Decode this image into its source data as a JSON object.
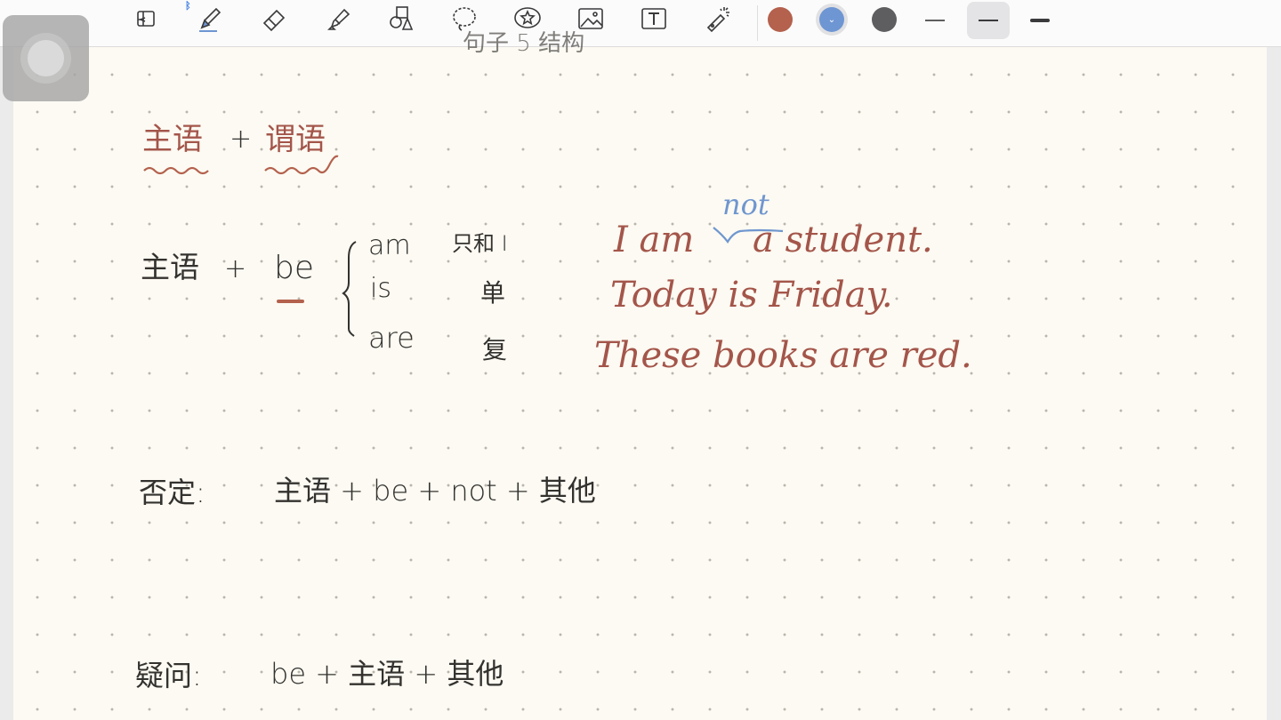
{
  "toolbar": {
    "tools": [
      {
        "id": "read-mode",
        "icon": "read-mode-icon",
        "selected": false
      },
      {
        "id": "pen",
        "icon": "pen-icon",
        "selected": true
      },
      {
        "id": "eraser",
        "icon": "eraser-icon",
        "selected": false
      },
      {
        "id": "highlighter",
        "icon": "highlighter-icon",
        "selected": false
      },
      {
        "id": "shapes",
        "icon": "shapes-icon",
        "selected": false
      },
      {
        "id": "lasso",
        "icon": "lasso-icon",
        "selected": false
      },
      {
        "id": "sticker",
        "icon": "star-bubble-icon",
        "selected": false
      },
      {
        "id": "image",
        "icon": "image-icon",
        "selected": false
      },
      {
        "id": "text",
        "icon": "text-box-icon",
        "selected": false
      },
      {
        "id": "laser",
        "icon": "laser-pointer-icon",
        "selected": false
      }
    ],
    "bluetooth_icon": "bluetooth-icon",
    "colors": [
      {
        "name": "brown-red",
        "hex": "#b4614d",
        "active": false
      },
      {
        "name": "blue",
        "hex": "#6e96d3",
        "active": true
      },
      {
        "name": "dark-gray",
        "hex": "#5e5e60",
        "active": false
      }
    ],
    "stroke_widths": [
      "thin",
      "medium",
      "thick"
    ],
    "selected_stroke": "medium"
  },
  "floating_button": {
    "icon": "assistive-touch-icon"
  },
  "note": {
    "heading_partial": "句子 5 结构",
    "line1": {
      "subject": "主语",
      "plus": "+",
      "predicate": "谓语"
    },
    "line2": {
      "subject": "主语",
      "plus": "+",
      "verb": "be"
    },
    "be_forms": [
      {
        "form": "am",
        "usage": "只和 I"
      },
      {
        "form": "is",
        "usage": "单"
      },
      {
        "form": "are",
        "usage": "复"
      }
    ],
    "examples": [
      {
        "prefix": "I am",
        "suffix": "a student."
      },
      {
        "text": "Today is Friday."
      },
      {
        "text": "These books are red."
      }
    ],
    "insertion": "not",
    "negative": {
      "label": "否定:",
      "formula": "主语 + be + not + 其他"
    },
    "question": {
      "label": "疑问:",
      "formula": "be + 主语 + 其他"
    }
  }
}
